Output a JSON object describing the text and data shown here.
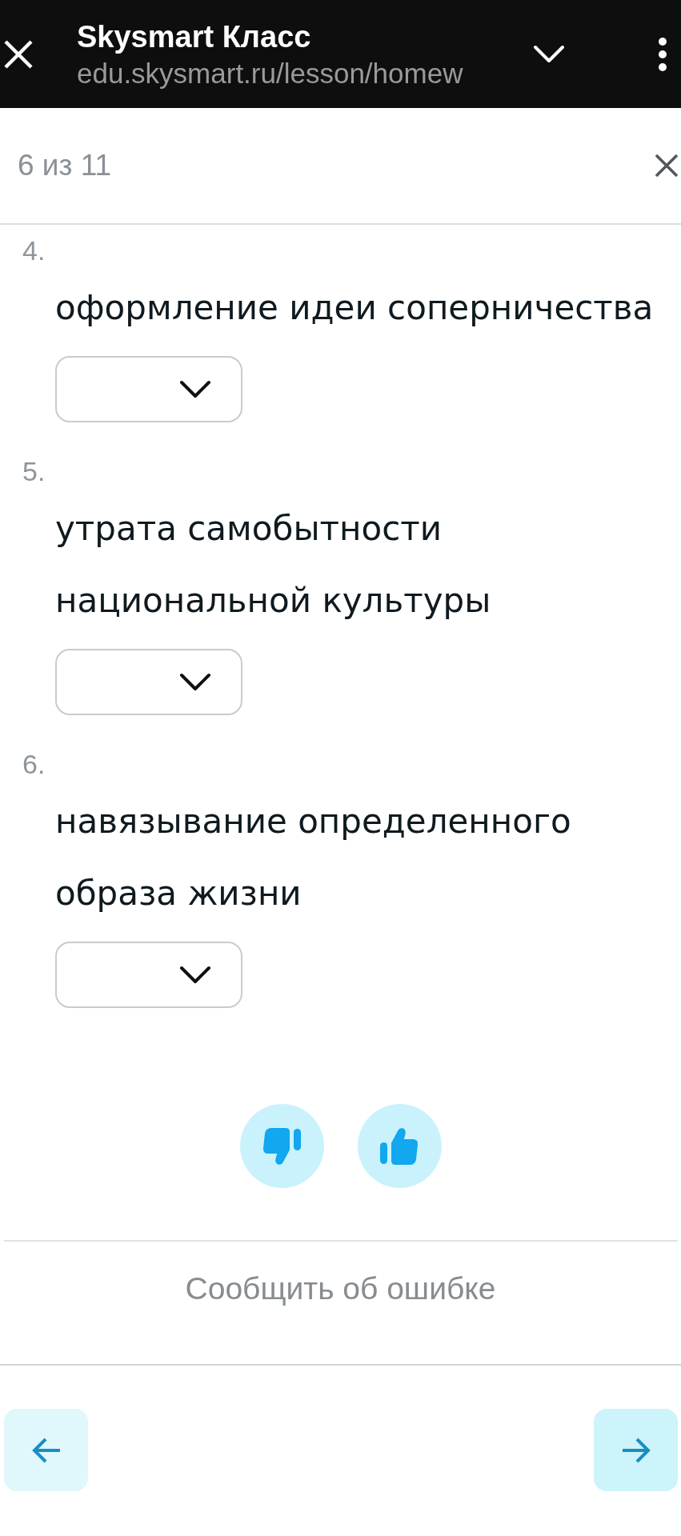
{
  "browser": {
    "title": "Skysmart Класс",
    "url": "edu.skysmart.ru/lesson/homew"
  },
  "header": {
    "progress": "6 из 11"
  },
  "questions": [
    {
      "number": "4.",
      "text": "оформление идеи соперничества"
    },
    {
      "number": "5.",
      "text": "утрата самобытности национальной культуры"
    },
    {
      "number": "6.",
      "text": "навязывание определенного образа жизни"
    }
  ],
  "feedback": [
    {
      "kind": "dislike",
      "selected": false
    },
    {
      "kind": "like",
      "selected": false
    }
  ],
  "report_link": "Сообщить об ошибке",
  "navigation": [
    {
      "kind": "previous"
    },
    {
      "kind": "next"
    }
  ]
}
